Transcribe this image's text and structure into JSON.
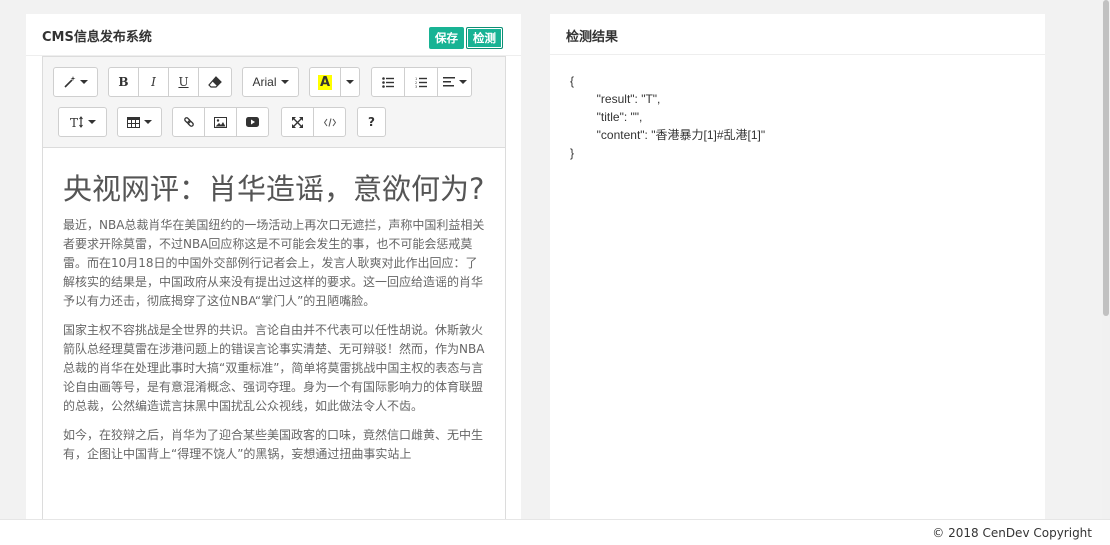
{
  "left": {
    "title": "CMS信息发布系统",
    "buttons": {
      "save": "保存",
      "check": "检测"
    },
    "toolbar": {
      "font_name": "Arial",
      "highlight_glyph": "A",
      "help_glyph": "?"
    },
    "article": {
      "title": "央视网评：肖华造谣，意欲何为?",
      "paragraphs": [
        "最近，NBA总裁肖华在美国纽约的一场活动上再次口无遮拦，声称中国利益相关者要求开除莫雷，不过NBA回应称这是不可能会发生的事，也不可能会惩戒莫雷。而在10月18日的中国外交部例行记者会上，发言人耿爽对此作出回应：了解核实的结果是，中国政府从来没有提出过这样的要求。这一回应给造谣的肖华予以有力还击，彻底揭穿了这位NBA“掌门人”的丑陋嘴脸。",
        "国家主权不容挑战是全世界的共识。言论自由并不代表可以任性胡说。休斯敦火箭队总经理莫雷在涉港问题上的错误言论事实清楚、无可辩驳！然而，作为NBA总裁的肖华在处理此事时大搞“双重标准”，简单将莫雷挑战中国主权的表态与言论自由画等号，是有意混淆概念、强词夺理。身为一个有国际影响力的体育联盟的总裁，公然编造谎言抹黑中国扰乱公众视线，如此做法令人不齿。",
        "如今，在狡辩之后，肖华为了迎合某些美国政客的口味，竟然信口雌黄、无中生有，企图让中国背上“得理不饶人”的黑锅，妄想通过扭曲事实站上"
      ]
    }
  },
  "right": {
    "title": "检测结果",
    "json_lines": [
      "{",
      "        \"result\": \"T\",",
      "        \"title\": \"\",",
      "        \"content\": \"香港暴力[1]#乱港[1]\"",
      "}"
    ]
  },
  "footer": {
    "copyright": "© 2018 CenDev Copyright"
  },
  "colors": {
    "accent": "#18b394",
    "highlight": "#ffff00"
  }
}
